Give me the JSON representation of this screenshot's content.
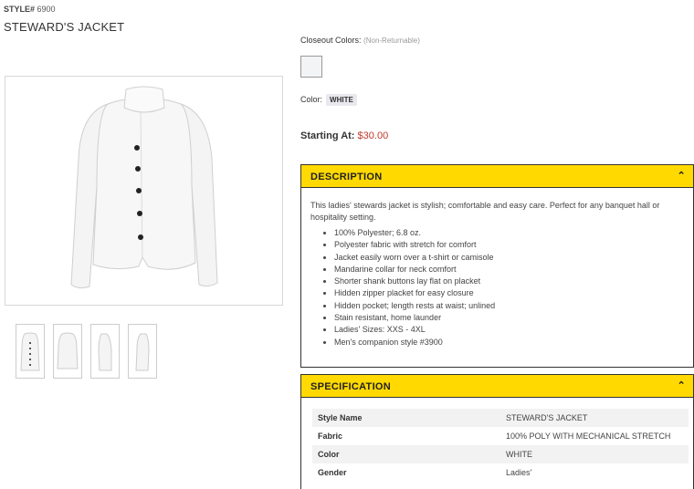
{
  "product": {
    "style_label": "STYLE#",
    "style_number": "6900",
    "title": "STEWARD'S JACKET"
  },
  "colors": {
    "closeout_label": "Closeout Colors:",
    "closeout_note": "(Non-Returnable)",
    "color_label": "Color:",
    "selected_color": "WHITE",
    "swatch_color": "#f3f4f6"
  },
  "price": {
    "label": "Starting At:",
    "value": "$30.00"
  },
  "description": {
    "heading": "DESCRIPTION",
    "text": "This ladies' stewards jacket is stylish; comfortable and easy care. Perfect for any banquet hall or hospitality setting.",
    "bullets": [
      "100% Polyester; 6.8 oz.",
      "Polyester fabric with stretch for comfort",
      "Jacket easily worn over a t-shirt or camisole",
      "Mandarine collar for neck comfort",
      "Shorter shank buttons lay flat on placket",
      "Hidden zipper placket for easy closure",
      "Hidden pocket; length rests at waist; unlined",
      "Stain resistant, home launder",
      "Ladies' Sizes: XXS - 4XL",
      "Men's companion style #3900"
    ]
  },
  "specification": {
    "heading": "SPECIFICATION",
    "rows": [
      {
        "key": "Style Name",
        "value": "STEWARD'S JACKET"
      },
      {
        "key": "Fabric",
        "value": "100% POLY WITH MECHANICAL STRETCH"
      },
      {
        "key": "Color",
        "value": "WHITE"
      },
      {
        "key": "Gender",
        "value": "Ladies'"
      }
    ]
  },
  "theme": {
    "accent": "#ffd900",
    "price_color": "#c0392b"
  }
}
